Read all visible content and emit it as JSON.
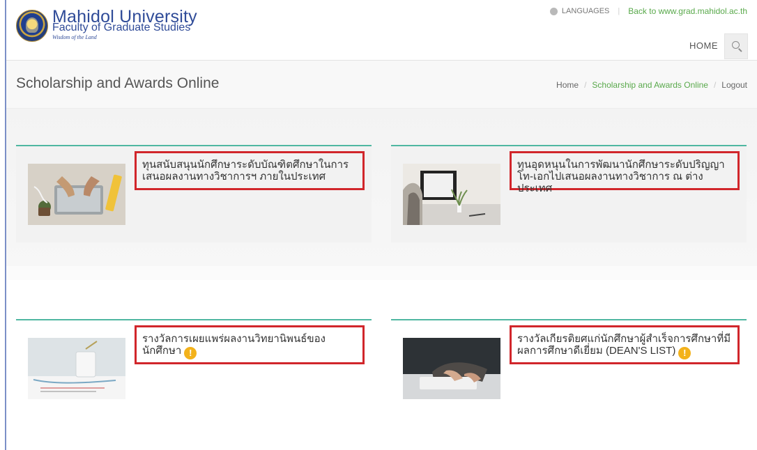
{
  "header": {
    "university": "Mahidol University",
    "faculty": "Faculty of Graduate Studies",
    "tagline": "Wisdom of the Land",
    "languages": "LANGUAGES",
    "back_link": "Back to www.grad.mahidol.ac.th",
    "nav_home": "HOME"
  },
  "page": {
    "title": "Scholarship and Awards Online",
    "breadcrumb": [
      "Home",
      "Scholarship and Awards Online",
      "Logout"
    ]
  },
  "cards": [
    {
      "text": "ทุนสนับสนุนนักศึกษาระดับบัณฑิตศึกษาในการเสนอผลงานทางวิชาการฯ ภายในประเทศ"
    },
    {
      "text": "ทุนอุดหนุนในการพัฒนานักศึกษาระดับปริญญาโท-เอกไปเสนอผลงานทางวิชาการ ณ ต่างประเทศ"
    },
    {
      "text": "รางวัลการเผยแพร่ผลงานวิทยานิพนธ์ของนักศึกษา",
      "warning": "!"
    },
    {
      "text": "รางวัลเกียรติยศแก่นักศึกษาผู้สำเร็จการศึกษาที่มีผลการศึกษาดีเยี่ยม (DEAN'S LIST)",
      "warning": "!"
    }
  ],
  "colors": {
    "accent_green": "#59a94b",
    "card_top_border": "#4fb7a1",
    "highlight_red": "#d1262b",
    "brand_blue": "#2f4b98",
    "warning_orange": "#f3b21b"
  }
}
